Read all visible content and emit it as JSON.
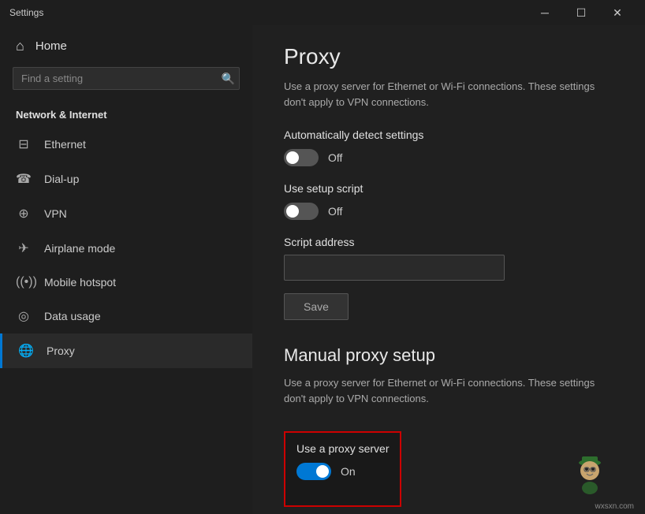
{
  "titleBar": {
    "title": "Settings",
    "minimizeLabel": "─",
    "maximizeLabel": "☐",
    "closeLabel": "✕"
  },
  "sidebar": {
    "homeLabel": "Home",
    "searchPlaceholder": "Find a setting",
    "sectionHeader": "Network & Internet",
    "navItems": [
      {
        "id": "ethernet",
        "label": "Ethernet",
        "icon": "🖥"
      },
      {
        "id": "dialup",
        "label": "Dial-up",
        "icon": "📞"
      },
      {
        "id": "vpn",
        "label": "VPN",
        "icon": "🔒"
      },
      {
        "id": "airplane",
        "label": "Airplane mode",
        "icon": "✈"
      },
      {
        "id": "hotspot",
        "label": "Mobile hotspot",
        "icon": "📶"
      },
      {
        "id": "data",
        "label": "Data usage",
        "icon": "📊"
      },
      {
        "id": "proxy",
        "label": "Proxy",
        "icon": "🌐"
      }
    ]
  },
  "content": {
    "pageTitle": "Proxy",
    "autoDetectSection": {
      "desc": "Use a proxy server for Ethernet or Wi-Fi connections. These settings don't apply to VPN connections.",
      "autoDetectLabel": "Automatically detect settings",
      "autoDetectState": "Off",
      "autoDetectOn": false,
      "setupScriptLabel": "Use setup script",
      "setupScriptState": "Off",
      "setupScriptOn": false,
      "scriptAddressLabel": "Script address",
      "scriptAddressPlaceholder": "",
      "saveLabel": "Save"
    },
    "manualSection": {
      "title": "Manual proxy setup",
      "desc": "Use a proxy server for Ethernet or Wi-Fi connections. These settings don't apply to VPN connections.",
      "useProxyLabel": "Use a proxy server",
      "useProxyState": "On",
      "useProxyOn": true
    }
  },
  "watermark": "wxsxn.com"
}
